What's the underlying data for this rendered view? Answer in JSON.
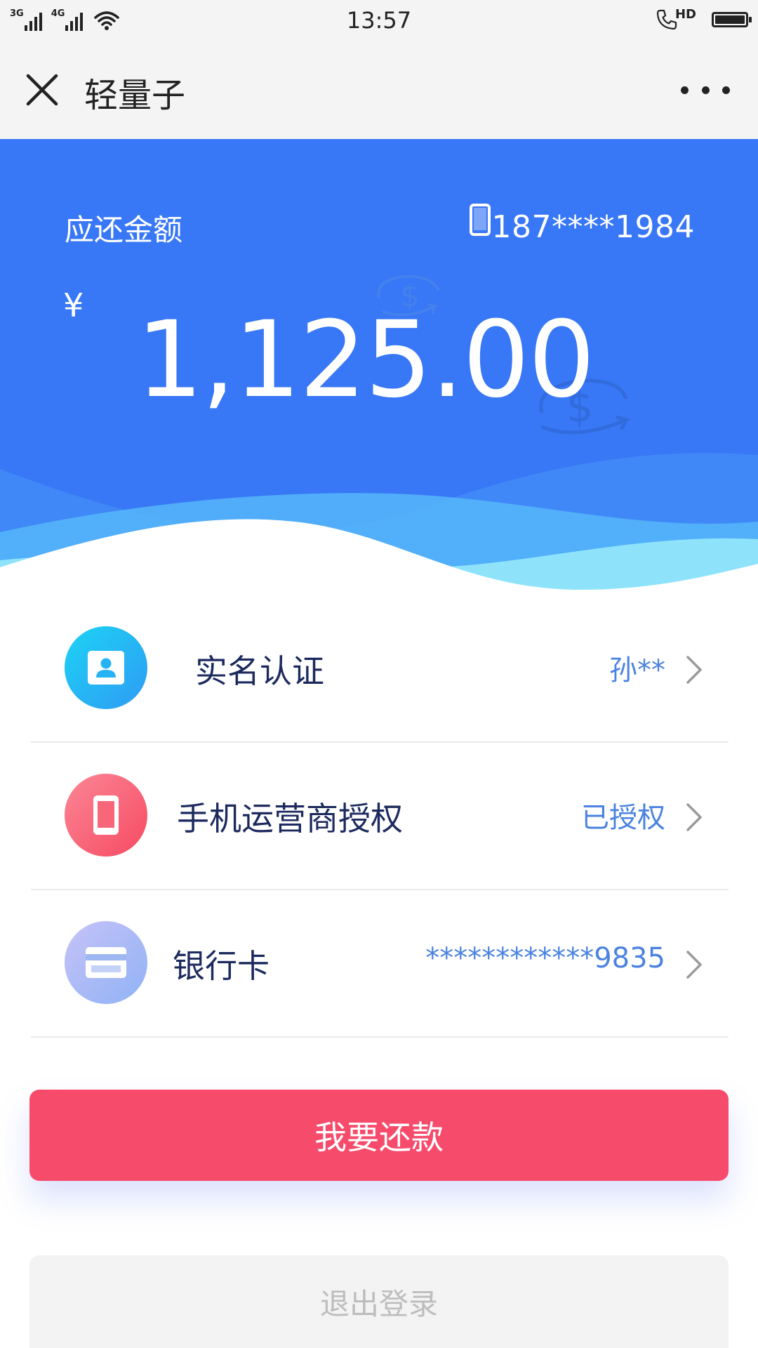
{
  "status_bar": {
    "network_1": "3G",
    "network_2": "4G",
    "time": "13:57",
    "hd_label": "HD",
    "icons": [
      "signal-icon",
      "wifi-icon",
      "phone-call-icon",
      "battery-icon"
    ]
  },
  "nav": {
    "title": "轻量子",
    "close_icon": "close-icon",
    "more_icon": "more-icon"
  },
  "repayment": {
    "label": "应还金额",
    "phone": "187****1984",
    "currency_symbol": "¥",
    "amount": "1,125.00"
  },
  "items": [
    {
      "label": "实名认证",
      "value": "孙**",
      "icon": "id-card-icon"
    },
    {
      "label": "手机运营商授权",
      "value": "已授权",
      "icon": "mobile-phone-icon"
    },
    {
      "label": "银行卡",
      "value": "************9835",
      "icon": "bank-card-icon"
    }
  ],
  "buttons": {
    "repay": "我要还款",
    "logout": "退出登录"
  },
  "colors": {
    "hero_blue": "#3877f5",
    "wave_light": "#56b6f9",
    "wave_cyan": "#8ee3fb",
    "primary_red": "#f74b6c",
    "text_navy": "#1c2a5e",
    "value_blue": "#4b83e0",
    "nav_background": "#f4f4f4"
  }
}
